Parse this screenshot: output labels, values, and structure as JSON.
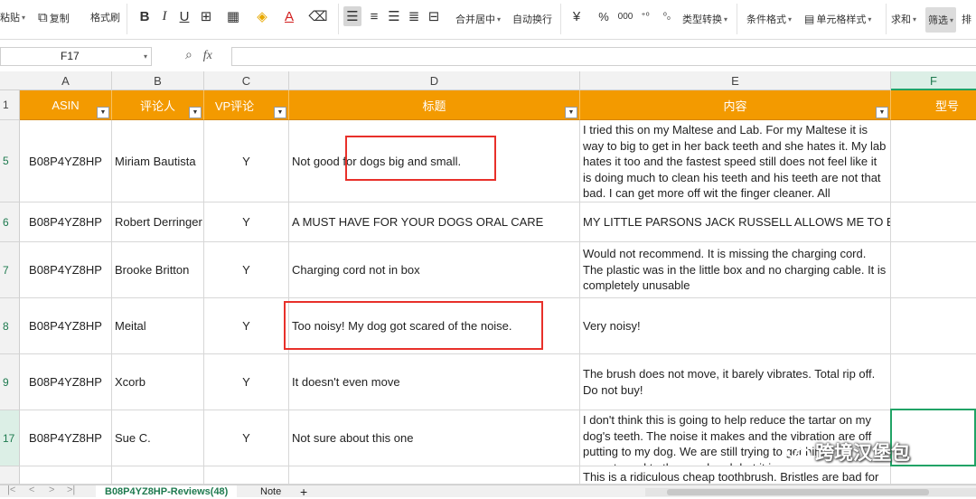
{
  "ribbon": {
    "paste": "粘贴",
    "copy": "复制",
    "format_painter": "格式刷",
    "bold": "B",
    "italic": "I",
    "underline": "U",
    "merge_center": "合并居中",
    "wrap_text": "自动换行",
    "currency": "¥",
    "percent": "%",
    "thousands": "000",
    "type_convert": "类型转换",
    "conditional_format": "条件格式",
    "cell_style": "单元格样式",
    "sum": "求和",
    "filter": "筛选",
    "sort": "排"
  },
  "formula_bar": {
    "name_box": "F17",
    "fx": "fx",
    "value": ""
  },
  "columns": [
    "A",
    "B",
    "C",
    "D",
    "E",
    "F"
  ],
  "header_row": {
    "row_number": "1",
    "cells": [
      "ASIN",
      "评论人",
      "VP评论",
      "标题",
      "内容",
      "型号"
    ]
  },
  "rows": [
    {
      "num": "5",
      "asin": "B08P4YZ8HP",
      "reviewer": "Miriam Bautista",
      "vp": "Y",
      "title": "Not good for dogs big and small.",
      "content": "I tried this on my Maltese and Lab. For my Maltese it is way to big to get in her back teeth and she hates it. My lab hates it too and the fastest speed still does not feel like it is doing much to clean his teeth and his teeth are not that bad. I can get more off wit the finger cleaner. All"
    },
    {
      "num": "6",
      "asin": "B08P4YZ8HP",
      "reviewer": "Robert Derringer",
      "vp": "Y",
      "title": "A MUST HAVE FOR YOUR DOGS ORAL CARE",
      "content": "MY LITTLE PARSONS JACK RUSSELL ALLOWS ME TO BRUS"
    },
    {
      "num": "7",
      "asin": "B08P4YZ8HP",
      "reviewer": "Brooke Britton",
      "vp": "Y",
      "title": "Charging cord not in box",
      "content": "Would not recommend. It is missing the charging cord. The plastic was in the little box and no charging cable. It is completely unusable"
    },
    {
      "num": "8",
      "asin": "B08P4YZ8HP",
      "reviewer": "Meital",
      "vp": "Y",
      "title": "Too noisy! My dog got scared of the noise.",
      "content": "Very noisy!"
    },
    {
      "num": "9",
      "asin": "B08P4YZ8HP",
      "reviewer": "Xcorb",
      "vp": "Y",
      "title": "It doesn't even move",
      "content": "The brush does not move, it barely vibrates. Total rip off. Do not buy!"
    },
    {
      "num": "17",
      "asin": "B08P4YZ8HP",
      "reviewer": "Sue C.",
      "vp": "Y",
      "title": "Not sure about this one",
      "content": "I don't think this is going to help reduce the tartar on my dog's teeth. The noise it makes and the vibration are off putting to my dog. We are still trying to get him accustomed to the new brush but it is"
    },
    {
      "num": "",
      "asin": "",
      "reviewer": "",
      "vp": "",
      "title": "",
      "content": "This is a ridiculous cheap toothbrush. Bristles are bad for"
    }
  ],
  "sheet_tabs": {
    "active": "B08P4YZ8HP-Reviews(48)",
    "other": "Note",
    "add": "+"
  },
  "watermark": "跨境汉堡包",
  "colors": {
    "header_fill": "#F39A00",
    "header_text": "#FFFFFF",
    "highlight_border": "#E8302A",
    "selection": "#21A366"
  }
}
